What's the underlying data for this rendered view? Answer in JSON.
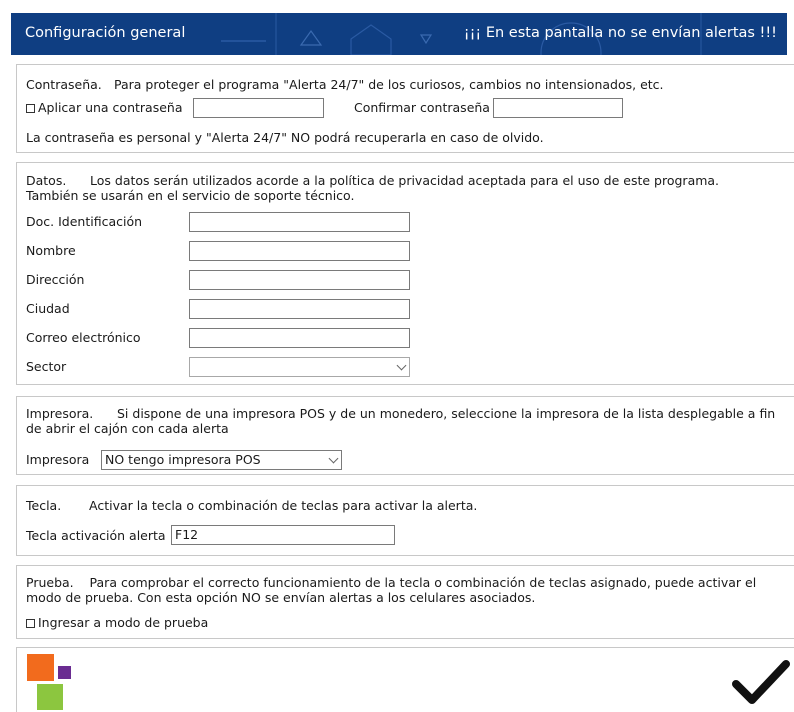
{
  "header": {
    "title": "Configuración general",
    "alert": "¡¡¡ En esta pantalla no se envían alertas !!!"
  },
  "password": {
    "heading": "Contraseña.",
    "description": "Para proteger el programa \"Alerta 24/7\" de los curiosos, cambios no intensionados, etc.",
    "apply_label": "Aplicar una contraseña",
    "apply_checked": false,
    "password_value": "",
    "confirm_label": "Confirmar contraseña",
    "confirm_value": "",
    "note": "La contraseña es personal y \"Alerta 24/7\" NO podrá recuperarla en caso de olvido."
  },
  "data": {
    "heading": "Datos.",
    "description_line1": "Los datos serán utilizados acorde a la política de privacidad aceptada para el uso de este programa.",
    "description_line2": "También se usarán en el servicio de soporte técnico.",
    "fields": [
      {
        "label": "Doc. Identificación",
        "value": ""
      },
      {
        "label": "Nombre",
        "value": ""
      },
      {
        "label": "Dirección",
        "value": ""
      },
      {
        "label": "Ciudad",
        "value": ""
      },
      {
        "label": "Correo electrónico",
        "value": ""
      }
    ],
    "sector_label": "Sector",
    "sector_value": ""
  },
  "printer": {
    "heading": "Impresora.",
    "description": "Si dispone de una impresora POS y de un monedero, seleccione la impresora de la lista desplegable a fin de abrir el cajón con cada alerta",
    "label": "Impresora",
    "selected": "NO tengo impresora POS"
  },
  "key": {
    "heading": "Tecla.",
    "description": "Activar la tecla o combinación de teclas para activar la alerta.",
    "label": "Tecla activación alerta",
    "value": "F12"
  },
  "test": {
    "heading": "Prueba.",
    "description": "Para comprobar el correcto funcionamiento de la tecla o combinación de teclas asignado, puede activar el modo de prueba. Con esta opción NO se envían alertas a los celulares asociados.",
    "checkbox_label": "Ingresar a modo de prueba",
    "checked": false
  },
  "colors": {
    "header_bg": "#0f3e82",
    "logo_orange": "#f26b1d",
    "logo_purple": "#6a2c91",
    "logo_green": "#8cc63f"
  },
  "icons": [
    "logo-icon",
    "checkmark-icon",
    "chevron-down-icon",
    "checkbox-icon"
  ]
}
